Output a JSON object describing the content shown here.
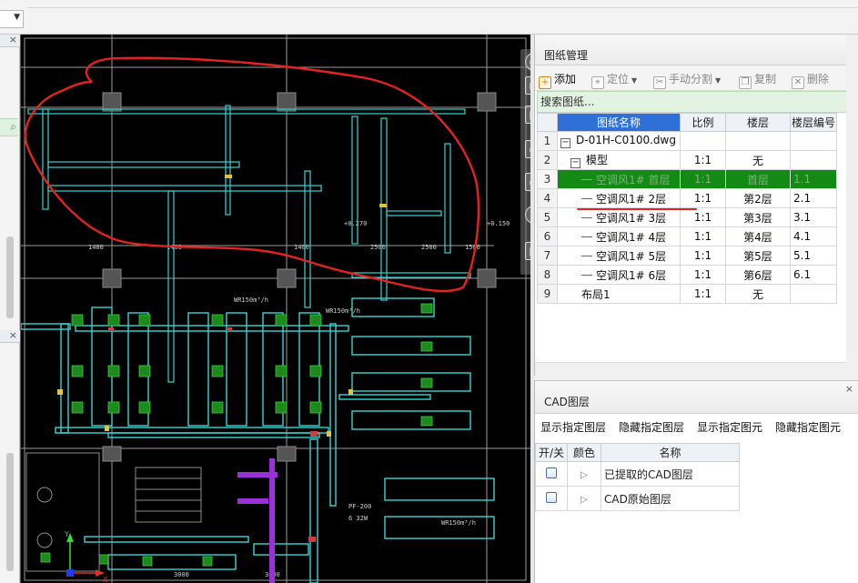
{
  "panel_drawings": {
    "title": "图纸管理",
    "toolbar": {
      "add": "添加",
      "locate": "定位",
      "manual_split": "手动分割",
      "copy": "复制",
      "delete": "删除"
    },
    "search_placeholder": "搜索图纸...",
    "columns": [
      "图纸名称",
      "比例",
      "楼层",
      "楼层编号"
    ],
    "rows": [
      {
        "n": "1",
        "name": "D-01H-C0100.dwg",
        "scale": "",
        "floor": "",
        "code": ""
      },
      {
        "n": "2",
        "name": "模型",
        "scale": "1:1",
        "floor": "无",
        "code": ""
      },
      {
        "n": "3",
        "name": "空调风1# 首层",
        "scale": "1:1",
        "floor": "首层",
        "code": "1.1"
      },
      {
        "n": "4",
        "name": "空调风1# 2层",
        "scale": "1:1",
        "floor": "第2层",
        "code": "2.1"
      },
      {
        "n": "5",
        "name": "空调风1# 3层",
        "scale": "1:1",
        "floor": "第3层",
        "code": "3.1"
      },
      {
        "n": "6",
        "name": "空调风1# 4层",
        "scale": "1:1",
        "floor": "第4层",
        "code": "4.1"
      },
      {
        "n": "7",
        "name": "空调风1# 5层",
        "scale": "1:1",
        "floor": "第5层",
        "code": "5.1"
      },
      {
        "n": "8",
        "name": "空调风1# 6层",
        "scale": "1:1",
        "floor": "第6层",
        "code": "6.1"
      },
      {
        "n": "9",
        "name": "布局1",
        "scale": "1:1",
        "floor": "无",
        "code": ""
      }
    ]
  },
  "panel_cad_layers": {
    "title": "CAD图层",
    "actions": {
      "show_layer": "显示指定图层",
      "hide_layer": "隐藏指定图层",
      "show_element": "显示指定图元",
      "hide_element": "隐藏指定图元"
    },
    "columns": [
      "开/关",
      "颜色",
      "名称"
    ],
    "rows": [
      {
        "name": "已提取的CAD图层"
      },
      {
        "name": "CAD原始图层"
      }
    ]
  },
  "drawing": {
    "dims": [
      "1400",
      "1400",
      "1400",
      "2500",
      "2500",
      "1500"
    ],
    "elevations": [
      "+0.270",
      "+0.150"
    ],
    "labels": [
      "WR150m³/h",
      "WR150m³/h",
      "PF-200",
      "6    32W",
      "WR150m³/h",
      "3000",
      "3000"
    ],
    "ucs": {
      "x": "X",
      "y": "Y"
    }
  },
  "colors": {
    "duct": "#33d6d6",
    "markup": "#e52222",
    "selected_row": "#138a13",
    "header_accent": "#2f70d8",
    "search_bg": "#e3f3e2",
    "purple_duct": "#9b30d9"
  }
}
